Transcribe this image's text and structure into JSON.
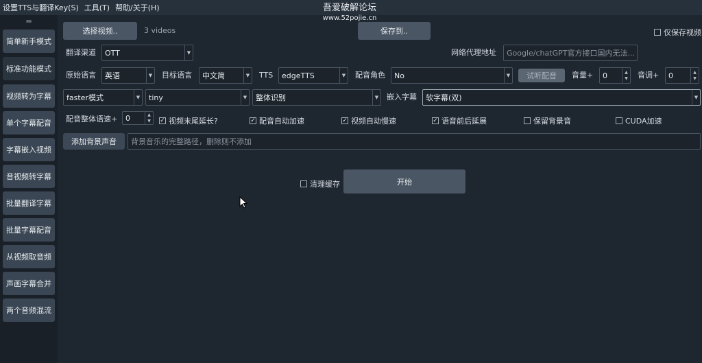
{
  "menu": [
    "设置TTS与翻译Key(S)",
    "工具(T)",
    "帮助/关于(H)"
  ],
  "watermark": {
    "title": "吾爱破解论坛",
    "url": "www.52pojie.cn"
  },
  "sidebar": {
    "handle": "═",
    "items": [
      "简单新手模式",
      "标准功能模式",
      "视频转为字幕",
      "单个字幕配音",
      "字幕嵌入视频",
      "音视频转字幕",
      "批量翻译字幕",
      "批量字幕配音",
      "从视频取音频",
      "声画字幕合并",
      "两个音频混流"
    ],
    "active_index": 1
  },
  "row1": {
    "select_video": "选择视频..",
    "video_count": "3 videos",
    "save_to": "保存到..",
    "only_save_video": "仅保存视频",
    "only_save_video_checked": false
  },
  "row2": {
    "translate_channel_label": "翻译渠道",
    "translate_channel": "OTT",
    "proxy_label": "网络代理地址",
    "proxy_placeholder": "Google/chatGPT官方接口国内无法..."
  },
  "row3": {
    "source_lang_label": "原始语言",
    "source_lang": "英语",
    "target_lang_label": "目标语言",
    "target_lang": "中文简",
    "tts_label": "TTS",
    "tts": "edgeTTS",
    "voice_role_label": "配音角色",
    "voice_role": "No",
    "listen_button": "试听配音",
    "volume_label": "音量+",
    "volume": "0",
    "pitch_label": "音调+",
    "pitch": "0"
  },
  "row4": {
    "mode": "faster模式",
    "model": "tiny",
    "recognition": "整体识别",
    "embed_sub_label": "嵌入字幕",
    "embed_sub": "软字幕(双)"
  },
  "row5": {
    "speed_label": "配音整体语速+",
    "speed": "0",
    "checks": [
      {
        "label": "视频末尾延长?",
        "checked": true
      },
      {
        "label": "配音自动加速",
        "checked": true
      },
      {
        "label": "视频自动慢速",
        "checked": true
      },
      {
        "label": "语音前后延展",
        "checked": true
      },
      {
        "label": "保留背景音",
        "checked": false
      },
      {
        "label": "CUDA加速",
        "checked": false
      }
    ]
  },
  "row6": {
    "add_bg_button": "添加背景声音",
    "bg_placeholder": "背景音乐的完整路径，删除则不添加"
  },
  "row7": {
    "clear_cache": "清理缓存",
    "clear_cache_checked": false,
    "start_button": "开始"
  },
  "colors": {
    "bg": "#1e2630",
    "sidebar_btn": "#3a4653",
    "button": "#4a5664"
  }
}
